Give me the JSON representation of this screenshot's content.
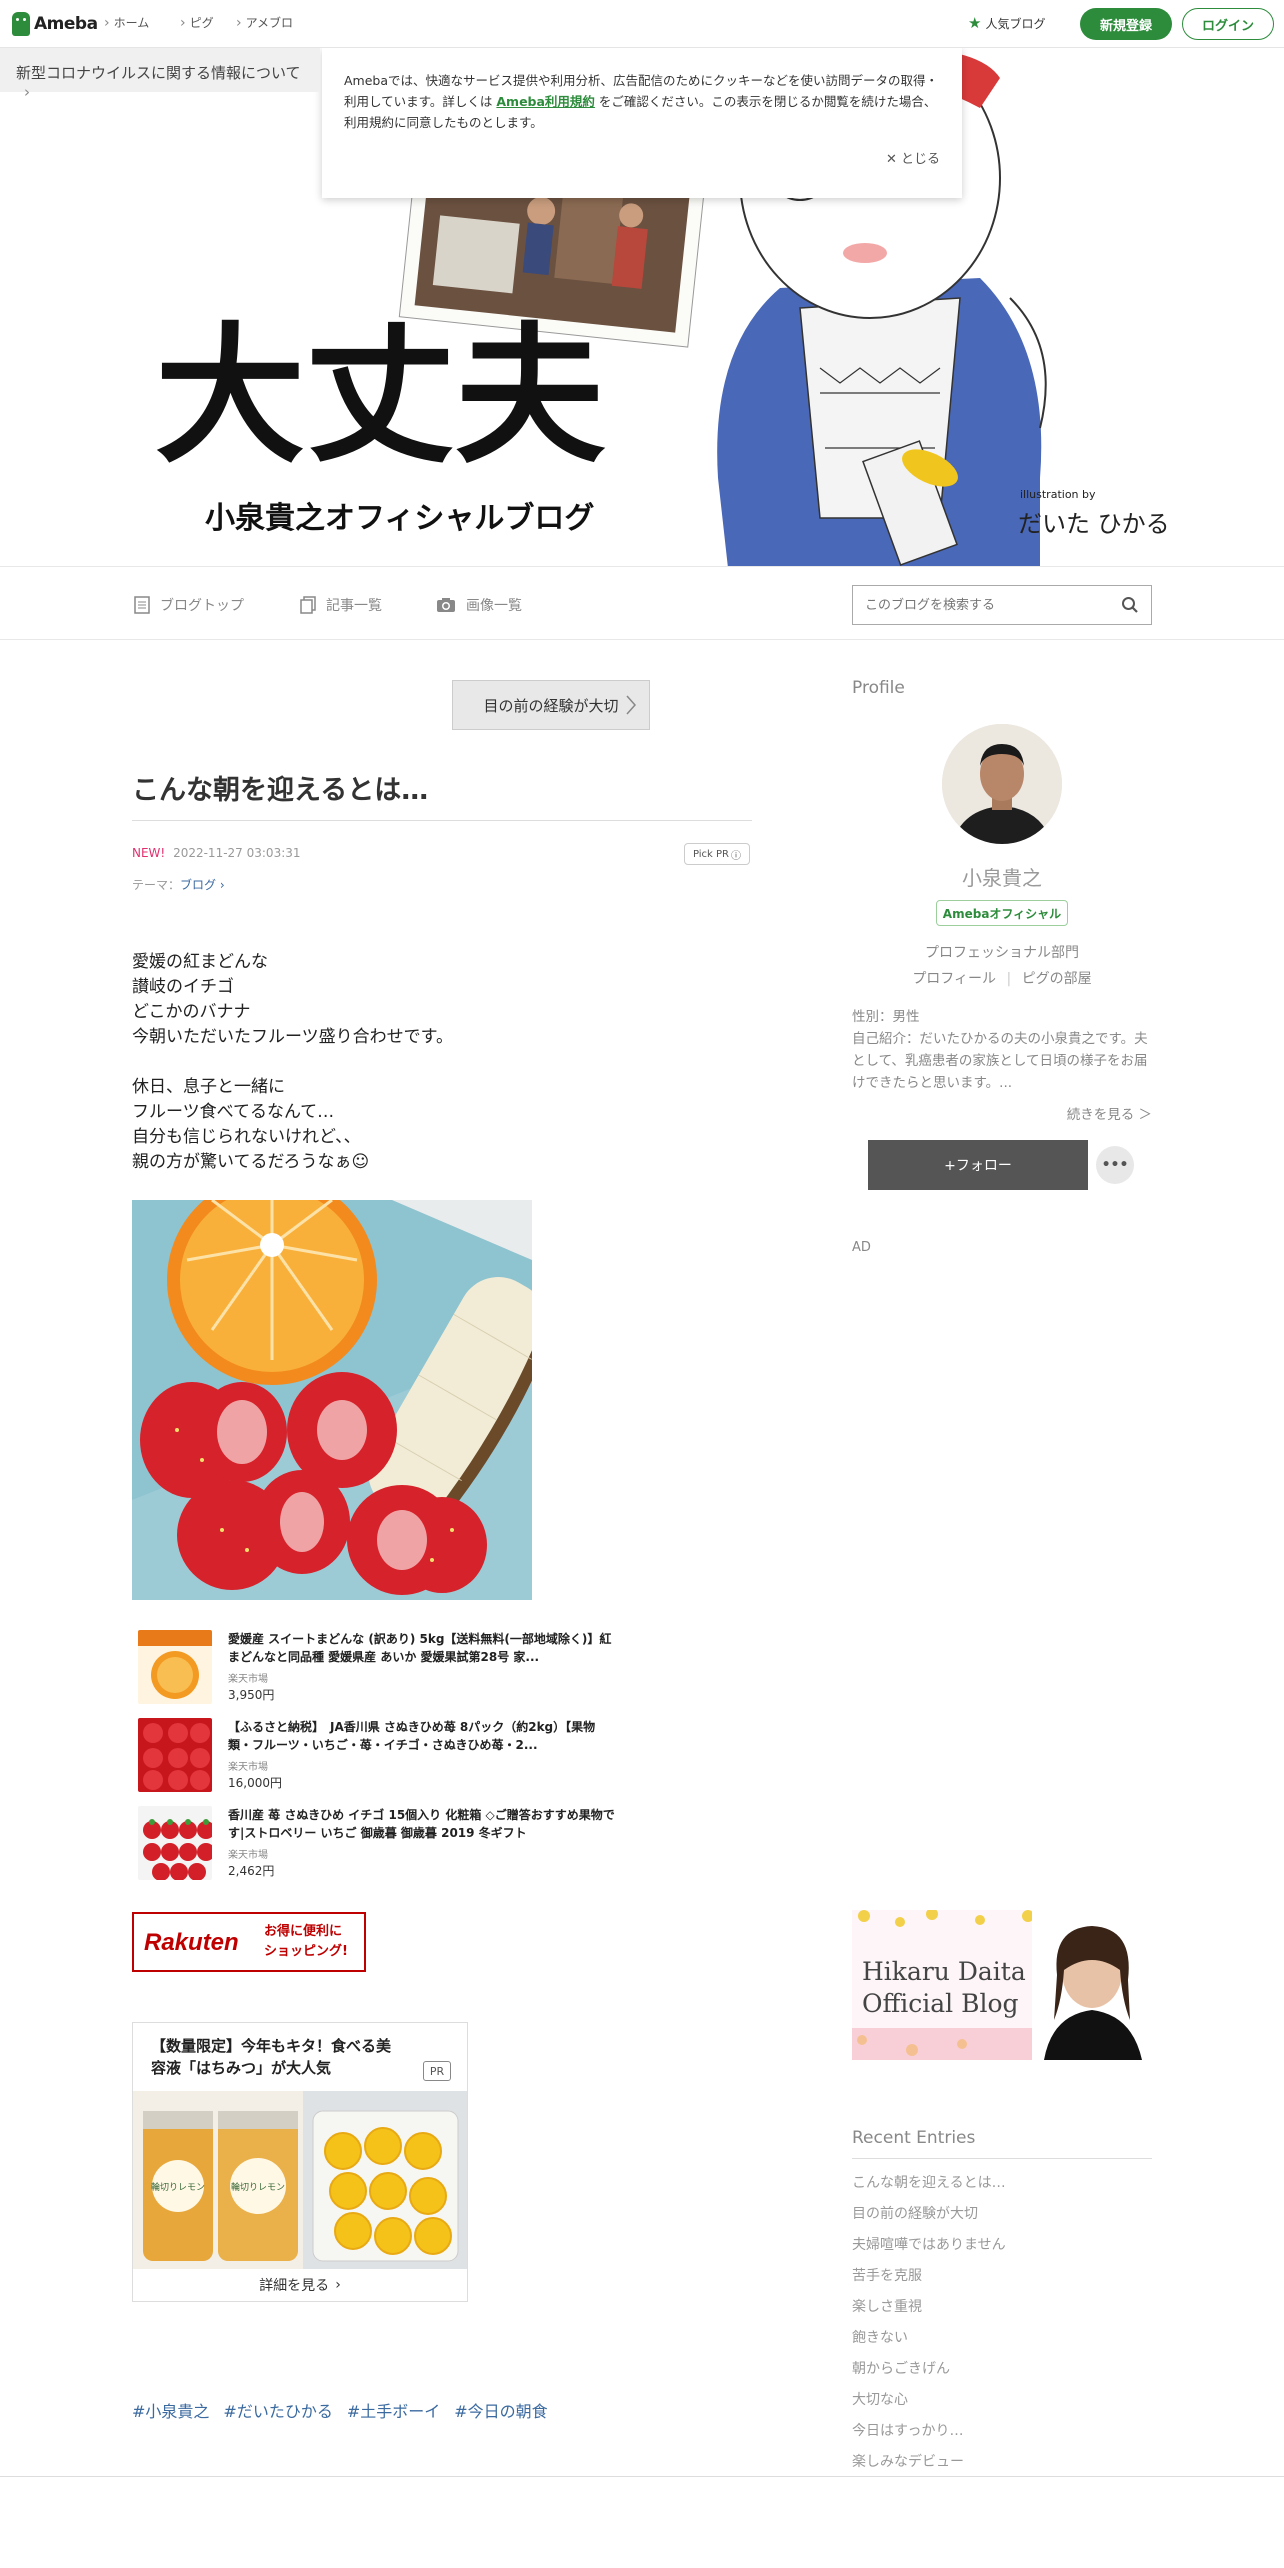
{
  "topbar": {
    "logo": "Ameba",
    "nav": [
      "ホーム",
      "ピグ",
      "アメブロ"
    ],
    "popular": "人気ブログ",
    "signup": "新規登録",
    "login": "ログイン"
  },
  "corona_notice": "新型コロナウイルスに関する情報について",
  "cookie": {
    "text_before": "Amebaでは、快適なサービス提供や利用分析、広告配信のためにクッキーなどを使い訪問データの取得・利用しています。詳しくは",
    "link": "Ameba利用規約",
    "text_after": "をご確認ください。この表示を閉じるか閲覧を続けた場合、利用規約に同意したものとします。",
    "close": "とじる"
  },
  "header": {
    "title_kanji": "大丈夫",
    "subtitle": "小泉貴之オフィシャルブログ",
    "illustration_by": "illustration by",
    "illustrator": "だいた ひかる"
  },
  "subnav": {
    "items": [
      "ブログトップ",
      "記事一覧",
      "画像一覧"
    ],
    "search_placeholder": "このブログを検索する"
  },
  "article": {
    "theme_tag_button": "目の前の経験が大切",
    "title": "こんな朝を迎えるとは…",
    "new_label": "NEW!",
    "datetime": "2022-11-27 03:03:31",
    "pickpr": "Pick PR",
    "theme_label": "テーマ：",
    "theme": "ブログ",
    "body": "愛媛の紅まどんな\n讃岐のイチゴ\nどこかのバナナ\n今朝いただいたフルーツ盛り合わせです。\n\n休日、息子と一緒に\nフルーツ食べてるなんて…\n自分も信じられないけれど、、\n親の方が驚いてるだろうなぁ☺",
    "products": [
      {
        "name": "愛媛産 スイートまどんな (訳あり) 5kg【送料無料(一部地域除く)】紅まどんなと同品種 愛媛県産 あいか 愛媛果試第28号 家...",
        "shop": "楽天市場",
        "price": "3,950円"
      },
      {
        "name": "【ふるさと納税】　JA香川県 さぬきひめ苺 8パック（約2kg）【果物類・フルーツ・いちご・苺・イチゴ・さぬきひめ苺・2...",
        "shop": "楽天市場",
        "price": "16,000円"
      },
      {
        "name": "香川産 苺 さぬきひめ イチゴ 15個入り 化粧箱 ◇ご贈答おすすめ果物です|ストロベリー いちご 御歳暮 御歳暮 2019 冬ギフト",
        "shop": "楽天市場",
        "price": "2,462円"
      }
    ],
    "rakuten_logo": "Rakuten",
    "rakuten_copy1": "お得に便利に",
    "rakuten_copy2": "ショッピング!",
    "ad": {
      "title": "【数量限定】今年もキタ！食べる美容液「はちみつ」が大人気",
      "pr": "PR",
      "jar_label": "輪切りレモン",
      "more": "詳細を見る"
    },
    "hashtags": [
      "#小泉貴之",
      "#だいたひかる",
      "#土手ボーイ",
      "#今日の朝食"
    ]
  },
  "sidebar": {
    "profile_heading": "Profile",
    "name": "小泉貴之",
    "badge": "Amebaオフィシャル",
    "department": "プロフェッショナル部門",
    "profile_link": "プロフィール",
    "pig_link": "ピグの部屋",
    "gender": "性別：男性",
    "intro": "自己紹介：だいたひかるの夫の小泉貴之です。夫として、乳癌患者の家族として日頃の様子をお届けできたらと思います。...",
    "read_more": "続きを見る ＞",
    "follow": "+フォロー",
    "more": "•••",
    "ad_label": "AD",
    "banner_line1": "Hikaru Daita",
    "banner_line2": "Official Blog",
    "recent_heading": "Recent Entries",
    "recent": [
      "こんな朝を迎えるとは…",
      "目の前の経験が大切",
      "夫婦喧嘩ではありません",
      "苦手を克服",
      "楽しさ重視",
      "飽きない",
      "朝からごきげん",
      "大切な心",
      "今日はすっかり…",
      "楽しみなデビュー"
    ]
  }
}
